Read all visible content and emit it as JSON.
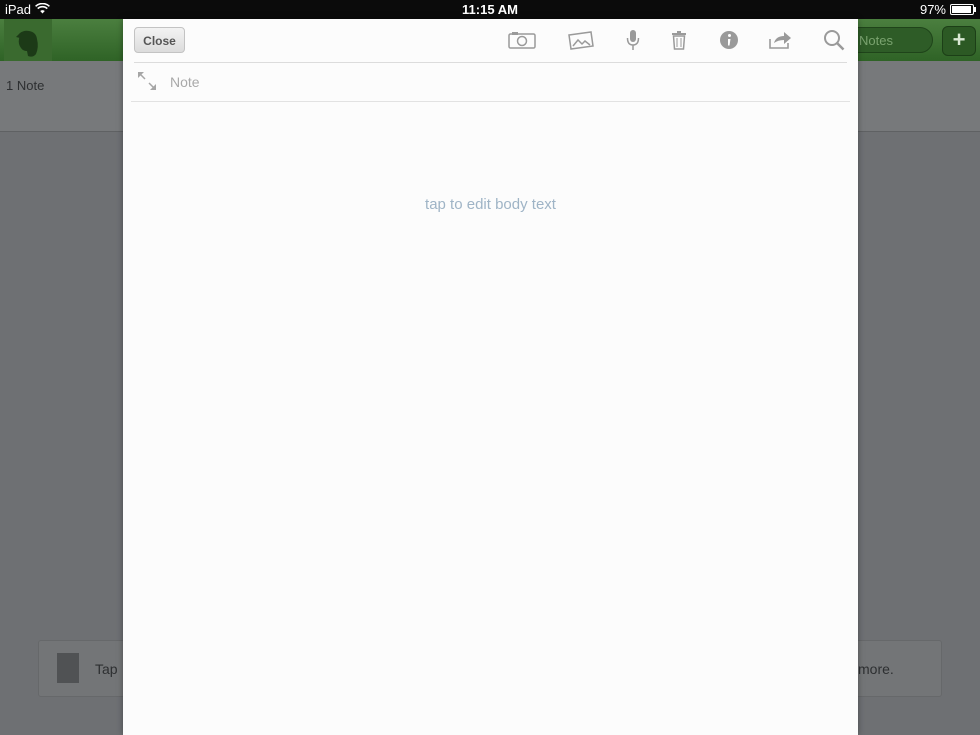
{
  "status_bar": {
    "device": "iPad",
    "time": "11:15 AM",
    "battery_text": "97%",
    "battery_level": 0.97
  },
  "background_app": {
    "search_text": "Notes",
    "note_count": "1 Note",
    "hint_left": "Tap",
    "hint_right": "more."
  },
  "editor": {
    "close_label": "Close",
    "toolbar_icons": [
      "camera-icon",
      "photo-library-icon",
      "microphone-icon",
      "trash-icon",
      "info-icon",
      "share-icon",
      "search-icon"
    ],
    "title_placeholder": "Note",
    "body_placeholder": "tap to edit body text"
  },
  "colors": {
    "brand_green": "#3f7436",
    "modal_background": "#fcfcfc",
    "placeholder_blue": "#9fb4c6"
  }
}
